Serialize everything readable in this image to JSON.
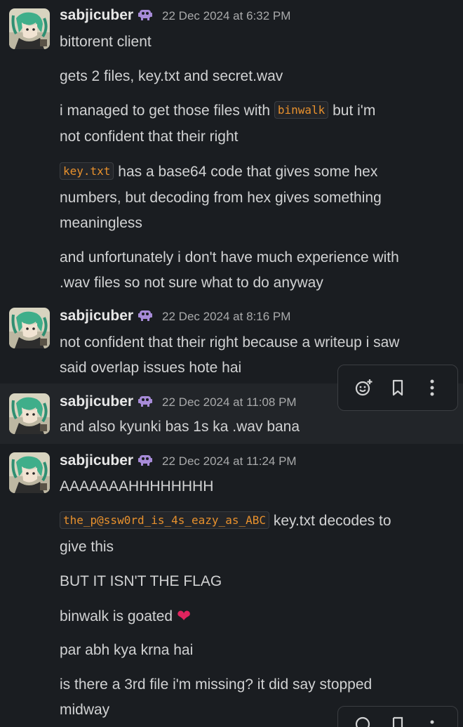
{
  "messages": [
    {
      "user": "sabjicuber",
      "time": "22 Dec 2024 at 6:32 PM",
      "lines": {
        "l1": "bittorent client",
        "l2": "gets 2 files, key.txt and secret.wav",
        "l3a": "i managed to get those files with ",
        "l3code": "binwalk",
        "l3b": " but i'm",
        "l4": "not confident that their right",
        "l5code": "key.txt",
        "l5b": " has a base64 code that gives some hex",
        "l6": "numbers, but decoding from hex gives something",
        "l7": "meaningless",
        "l8": "and unfortunately i don't have much experience with",
        "l9": ".wav files so not sure what to do anyway"
      }
    },
    {
      "user": "sabjicuber",
      "time": "22 Dec 2024 at 8:16 PM",
      "lines": {
        "l1": "not confident that their right because a writeup i saw",
        "l2": "said overlap issues hote hai"
      }
    },
    {
      "user": "sabjicuber",
      "time": "22 Dec 2024 at 11:08 PM",
      "lines": {
        "l1": "and also kyunki bas 1s ka .wav bana"
      }
    },
    {
      "user": "sabjicuber",
      "time": "22 Dec 2024 at 11:24 PM",
      "lines": {
        "l1": "AAAAAAAHHHHHHHH",
        "l2code": "the_p@ssw0rd_is_4s_eazy_as_ABC",
        "l2b": " key.txt decodes to",
        "l3": "give this",
        "l4": "BUT IT ISN'T THE FLAG",
        "l5": "binwalk is goated ",
        "l6": "par abh kya krna hai",
        "l7": "is there a 3rd file i'm missing? it did say stopped",
        "l8": "midway"
      }
    }
  ],
  "toolbar": {
    "icons": [
      "add-reaction-icon",
      "bookmark-icon",
      "more-vertical-icon"
    ]
  },
  "colors": {
    "background": "#1a1d21",
    "hover_background": "#222529",
    "code_text": "#e8912d",
    "heart": "#e0245e",
    "badge": "#a78bd8"
  }
}
